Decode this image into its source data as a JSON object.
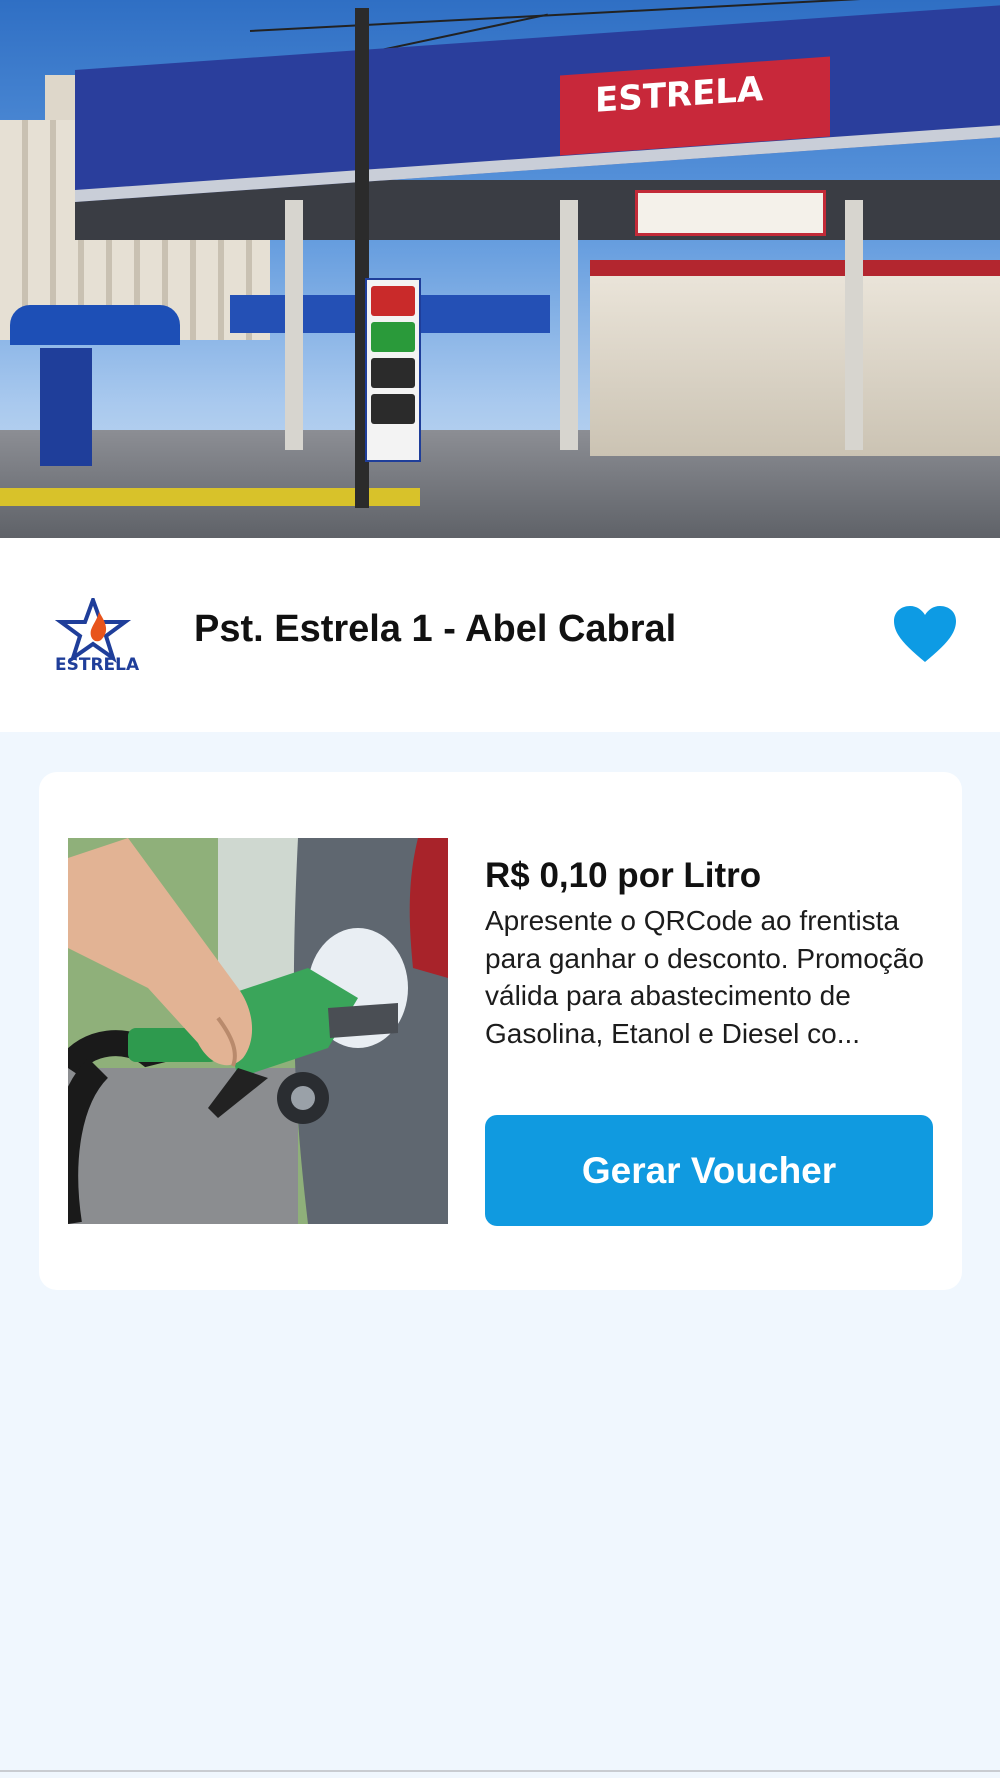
{
  "hero": {
    "canopy_brand_text": "ESTRELA",
    "image_alt": "Estrela gas station"
  },
  "station": {
    "name": "Pst. Estrela 1 - Abel Cabral",
    "logo_text": "ESTRELA",
    "favorite_icon": "heart-icon",
    "favorited": true
  },
  "offer": {
    "title": "R$ 0,10 por Litro",
    "description": "Apresente o QRCode ao frentista para ganhar o desconto. Promoção válida para abastecimento de Gasolina, Etanol e Diesel co...",
    "button_label": "Gerar Voucher",
    "image_alt": "fuel nozzle in car"
  },
  "colors": {
    "accent": "#109ae0",
    "heart": "#0d9be4",
    "background": "#f0f7fe",
    "card": "#ffffff",
    "brand_blue": "#1f3e9a",
    "brand_red": "#c8283a"
  }
}
